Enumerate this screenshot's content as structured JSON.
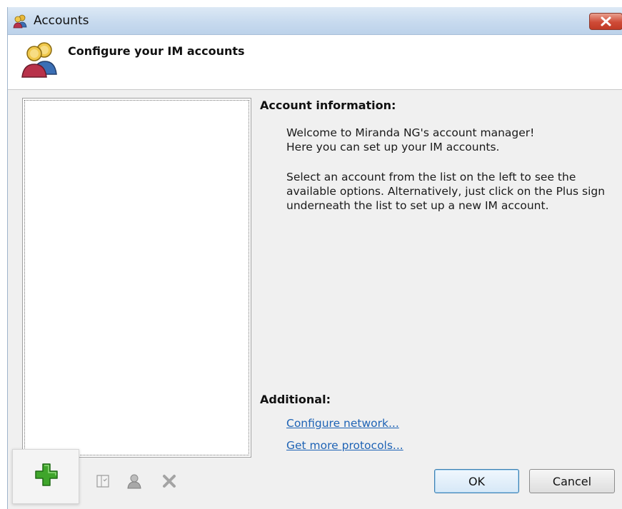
{
  "window": {
    "title": "Accounts",
    "title_icon": "users-icon",
    "close_icon": "close-icon"
  },
  "header": {
    "title": "Configure your IM accounts",
    "icon": "users-icon"
  },
  "account_list": {
    "items": []
  },
  "info": {
    "heading": "Account information:",
    "lines": [
      "Welcome to Miranda NG's account manager!",
      "Here you can set up your IM accounts.",
      "Select an account from the list on the left to see the",
      "available options. Alternatively, just click on the Plus sign",
      "underneath the list to set up a new IM account."
    ]
  },
  "additional": {
    "heading": "Additional:",
    "links": [
      "Configure network...",
      "Get more protocols..."
    ]
  },
  "toolbar": {
    "add_icon": "plus-icon",
    "edit_icon": "edit-icon",
    "user_icon": "user-icon",
    "delete_icon": "delete-icon"
  },
  "buttons": {
    "ok": "OK",
    "cancel": "Cancel"
  },
  "colors": {
    "link": "#1e63b5",
    "add_green": "#3fa52b",
    "close_red": "#cf4b37"
  }
}
